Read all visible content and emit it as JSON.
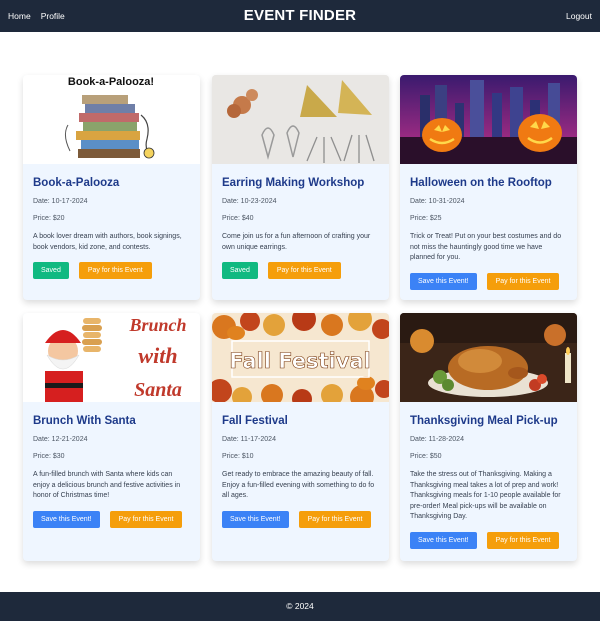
{
  "nav": {
    "home": "Home",
    "profile": "Profile",
    "brand": "EVENT FINDER",
    "logout": "Logout"
  },
  "events": [
    {
      "title": "Book-a-Palooza",
      "date": "Date: 10-17-2024",
      "price": "Price: $20",
      "description": "A book lover dream with authors, book signings, book vendors, kid zone, and contests.",
      "save_label": "Saved",
      "pay_label": "Pay for this Event",
      "image_caption": "Book-a-Palooza!"
    },
    {
      "title": "Earring Making Workshop",
      "date": "Date: 10-23-2024",
      "price": "Price: $40",
      "description": "Come join us for a fun afternoon of crafting your own unique earrings.",
      "save_label": "Saved",
      "pay_label": "Pay for this Event"
    },
    {
      "title": "Halloween on the Rooftop",
      "date": "Date: 10-31-2024",
      "price": "Price: $25",
      "description": "Trick or Treat! Put on your best costumes and do not miss the hauntingly good time we have planned for you.",
      "save_label": "Save this Event!",
      "pay_label": "Pay for this Event"
    },
    {
      "title": "Brunch With Santa",
      "date": "Date: 12-21-2024",
      "price": "Price: $30",
      "description": "A fun-filled brunch with Santa where kids can enjoy a delicious brunch and festive activities in honor of Christmas time!",
      "save_label": "Save this Event!",
      "pay_label": "Pay for this Event",
      "image_caption": "Brunch with Santa"
    },
    {
      "title": "Fall Festival",
      "date": "Date: 11-17-2024",
      "price": "Price: $10",
      "description": "Get ready to embrace the amazing beauty of fall. Enjoy a fun-filled evening with something to do fo all ages.",
      "save_label": "Save this Event!",
      "pay_label": "Pay for this Event",
      "image_caption": "Fall Festival"
    },
    {
      "title": "Thanksgiving Meal Pick-up",
      "date": "Date: 11-28-2024",
      "price": "Price: $50",
      "description": "Take the stress out of Thanksgiving. Making a Thanksgiving meal takes a lot of prep and work! Thanksgiving meals for 1-10 people available for pre-order! Meal pick-ups will be available on Thanksgiving Day.",
      "save_label": "Save this Event!",
      "pay_label": "Pay for this Event"
    }
  ],
  "footer": {
    "text": "© 2024"
  },
  "colors": {
    "nav_bg": "#1e293b",
    "card_bg": "#eff6ff",
    "title": "#1e3a8a",
    "saved": "#10b981",
    "save": "#3b82f6",
    "pay": "#f59e0b"
  }
}
